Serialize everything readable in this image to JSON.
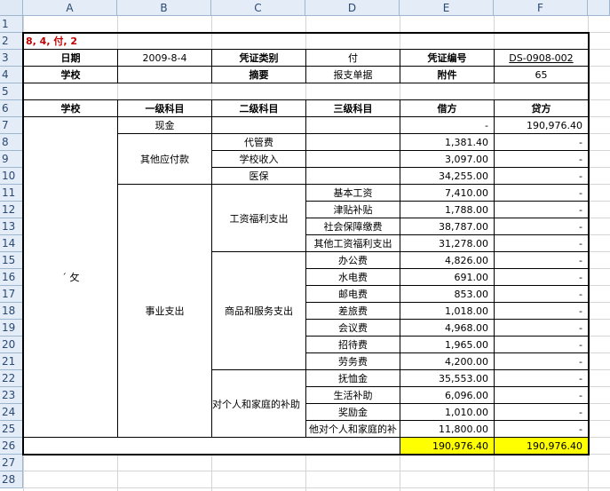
{
  "columns": [
    "A",
    "B",
    "C",
    "D",
    "E",
    "F"
  ],
  "rows": [
    "1",
    "2",
    "3",
    "4",
    "5",
    "6",
    "7",
    "8",
    "9",
    "10",
    "11",
    "12",
    "13",
    "14",
    "15",
    "16",
    "17",
    "18",
    "19",
    "20",
    "21",
    "22",
    "23",
    "24",
    "25",
    "26",
    "27",
    "28"
  ],
  "note": "8, 4, 付, 2",
  "header": {
    "date_label": "日期",
    "date_value": "2009-8-4",
    "voucher_type_label": "凭证类别",
    "voucher_type_value": "付",
    "voucher_no_label": "凭证编号",
    "voucher_no_value": "DS-0908-002",
    "school_label": "学校",
    "summary_label": "摘要",
    "summary_value": "报支单据",
    "attach_label": "附件",
    "attach_value": "65"
  },
  "table_headers": [
    "学校",
    "一级科目",
    "二级科目",
    "三级科目",
    "借方",
    "贷方"
  ],
  "school_text_fragment": "ˊ     攵",
  "level1": {
    "cash": "现金",
    "other_payables": "其他应付款",
    "business_expense": "事业支出"
  },
  "level2": {
    "daiguan": "代管费",
    "school_income": "学校收入",
    "medical": "医保",
    "salary_welfare": "工资福利支出",
    "goods_services": "商品和服务支出",
    "personal_subsidy": "对个人和家庭的补助"
  },
  "lines": [
    {
      "l3": "",
      "debit": "-",
      "credit": "190,976.40"
    },
    {
      "l3": "",
      "debit": "1,381.40",
      "credit": "-"
    },
    {
      "l3": "",
      "debit": "3,097.00",
      "credit": "-"
    },
    {
      "l3": "",
      "debit": "34,255.00",
      "credit": "-"
    },
    {
      "l3": "基本工资",
      "debit": "7,410.00",
      "credit": "-"
    },
    {
      "l3": "津贴补贴",
      "debit": "1,788.00",
      "credit": "-"
    },
    {
      "l3": "社会保障缴费",
      "debit": "38,787.00",
      "credit": "-"
    },
    {
      "l3": "其他工资福利支出",
      "debit": "31,278.00",
      "credit": "-"
    },
    {
      "l3": "办公费",
      "debit": "4,826.00",
      "credit": "-"
    },
    {
      "l3": "水电费",
      "debit": "691.00",
      "credit": "-"
    },
    {
      "l3": "邮电费",
      "debit": "853.00",
      "credit": "-"
    },
    {
      "l3": "差旅费",
      "debit": "1,018.00",
      "credit": "-"
    },
    {
      "l3": "会议费",
      "debit": "4,968.00",
      "credit": "-"
    },
    {
      "l3": "招待费",
      "debit": "1,965.00",
      "credit": "-"
    },
    {
      "l3": "劳务费",
      "debit": "4,200.00",
      "credit": "-"
    },
    {
      "l3": "抚恤金",
      "debit": "35,553.00",
      "credit": "-"
    },
    {
      "l3": "生活补助",
      "debit": "6,096.00",
      "credit": "-"
    },
    {
      "l3": "奖励金",
      "debit": "1,010.00",
      "credit": "-"
    },
    {
      "l3": "他对个人和家庭的补",
      "debit": "11,800.00",
      "credit": "-"
    }
  ],
  "totals": {
    "debit": "190,976.40",
    "credit": "190,976.40"
  },
  "colors": {
    "header_bg": "#e4ecf7",
    "grid": "#d4d4d4",
    "highlight": "#ffff00",
    "note": "#c00000"
  }
}
